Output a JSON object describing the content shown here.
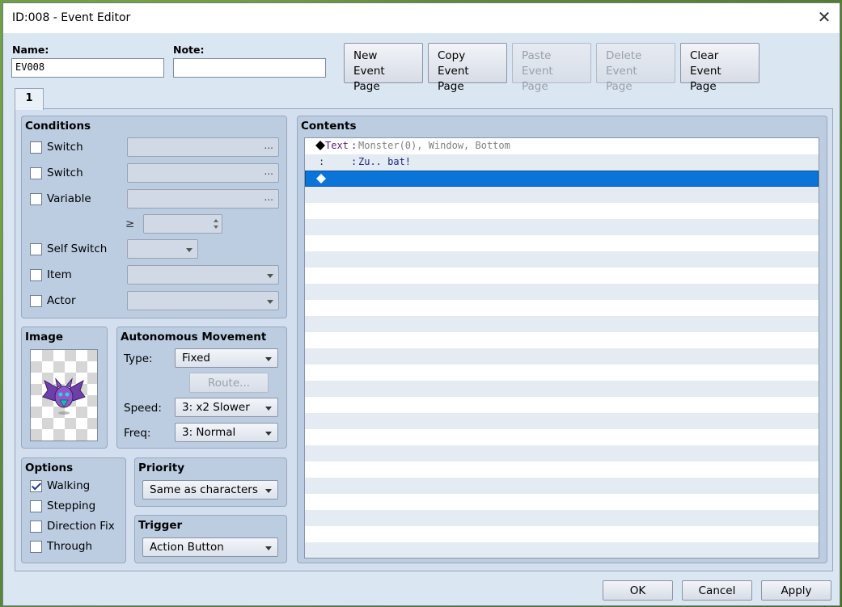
{
  "window": {
    "title": "ID:008 - Event Editor"
  },
  "name": {
    "label": "Name:",
    "value": "EV008"
  },
  "note": {
    "label": "Note:",
    "value": ""
  },
  "page_buttons": [
    {
      "line1": "New",
      "line2": "Event Page",
      "enabled": true
    },
    {
      "line1": "Copy",
      "line2": "Event Page",
      "enabled": true
    },
    {
      "line1": "Paste",
      "line2": "Event Page",
      "enabled": false
    },
    {
      "line1": "Delete",
      "line2": "Event Page",
      "enabled": false
    },
    {
      "line1": "Clear",
      "line2": "Event Page",
      "enabled": true
    }
  ],
  "tabs": [
    {
      "label": "1"
    }
  ],
  "conditions": {
    "title": "Conditions",
    "switch1": {
      "label": "Switch",
      "checked": false,
      "value": "",
      "button": "..."
    },
    "switch2": {
      "label": "Switch",
      "checked": false,
      "value": "",
      "button": "..."
    },
    "variable": {
      "label": "Variable",
      "checked": false,
      "value": "",
      "button": "...",
      "operator": "≥",
      "amount": ""
    },
    "self_switch": {
      "label": "Self Switch",
      "checked": false,
      "value": ""
    },
    "item": {
      "label": "Item",
      "checked": false,
      "value": ""
    },
    "actor": {
      "label": "Actor",
      "checked": false,
      "value": ""
    }
  },
  "image": {
    "title": "Image",
    "sprite": "bat-monster-icon"
  },
  "autonomous_movement": {
    "title": "Autonomous Movement",
    "type_label": "Type:",
    "type_value": "Fixed",
    "route_button": "Route...",
    "speed_label": "Speed:",
    "speed_value": "3: x2 Slower",
    "freq_label": "Freq:",
    "freq_value": "3: Normal"
  },
  "options": {
    "title": "Options",
    "items": [
      {
        "label": "Walking",
        "checked": true
      },
      {
        "label": "Stepping",
        "checked": false
      },
      {
        "label": "Direction Fix",
        "checked": false
      },
      {
        "label": "Through",
        "checked": false
      }
    ]
  },
  "priority": {
    "title": "Priority",
    "value": "Same as characters"
  },
  "trigger": {
    "title": "Trigger",
    "value": "Action Button"
  },
  "contents": {
    "title": "Contents",
    "lines": [
      {
        "prefix": "Text",
        "sep": ":",
        "text": "Monster(0), Window, Bottom"
      },
      {
        "prefix": ":",
        "sep": ":",
        "text": "Zu.. bat!"
      }
    ]
  },
  "footer": {
    "ok": "OK",
    "cancel": "Cancel",
    "apply": "Apply"
  },
  "colors": {
    "selection": "#0a74d8",
    "command_purple": "#5a1f7a",
    "text_navy": "#1b2a80"
  }
}
